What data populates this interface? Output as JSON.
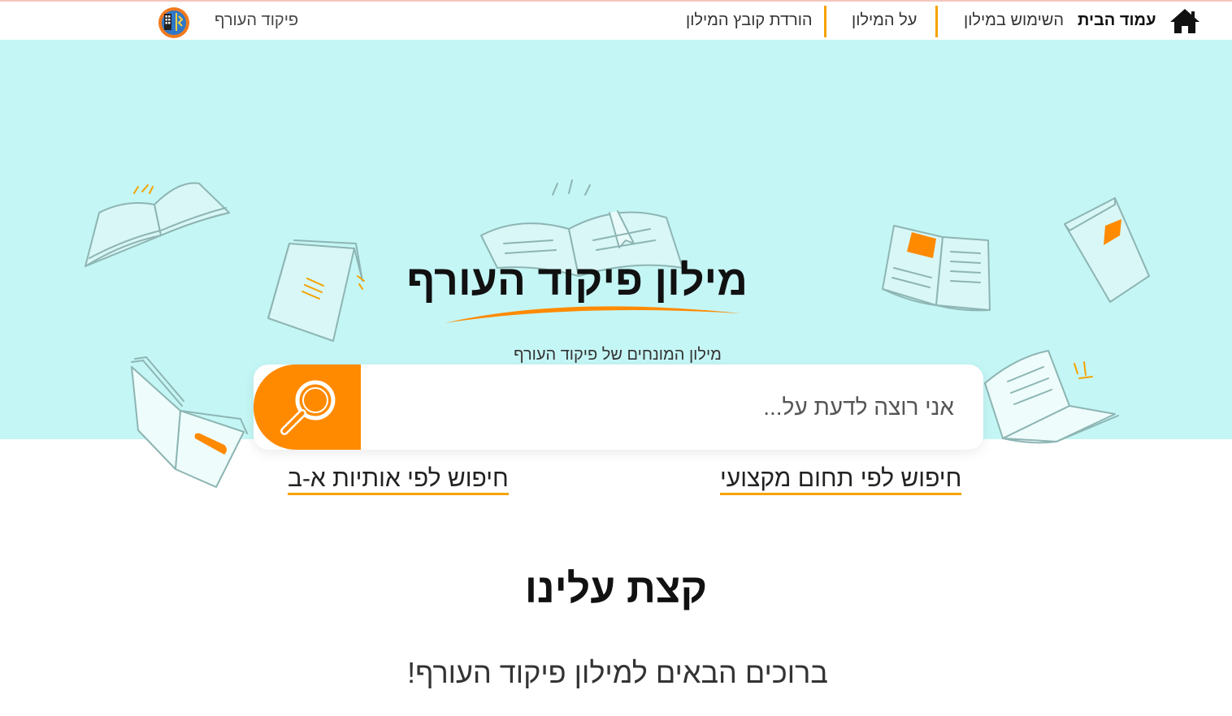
{
  "nav": {
    "home_label": "עמוד הבית",
    "usage_label": "השימוש במילון",
    "about_label": "על המילון",
    "download_label": "הורדת קובץ המילון",
    "brand_label": "פיקוד העורף"
  },
  "hero": {
    "title": "מילון פיקוד העורף",
    "subtitle": "מילון המונחים של פיקוד העורף"
  },
  "search": {
    "placeholder": "אני רוצה לדעת על...",
    "value": ""
  },
  "links": {
    "by_field": "חיפוש לפי תחום מקצועי",
    "by_alphabet": "חיפוש לפי אותיות א-ב"
  },
  "about": {
    "title": "קצת עלינו",
    "welcome": "ברוכים הבאים למילון פיקוד העורף!"
  },
  "colors": {
    "hero_bg": "#c4f6f5",
    "accent_orange": "#ff8a00",
    "separator_yellow": "#f5a300",
    "book_outline": "#8db5b3"
  },
  "icons": {
    "home": "home-icon",
    "logo": "home-front-command-logo",
    "search": "magnifier-icon"
  }
}
